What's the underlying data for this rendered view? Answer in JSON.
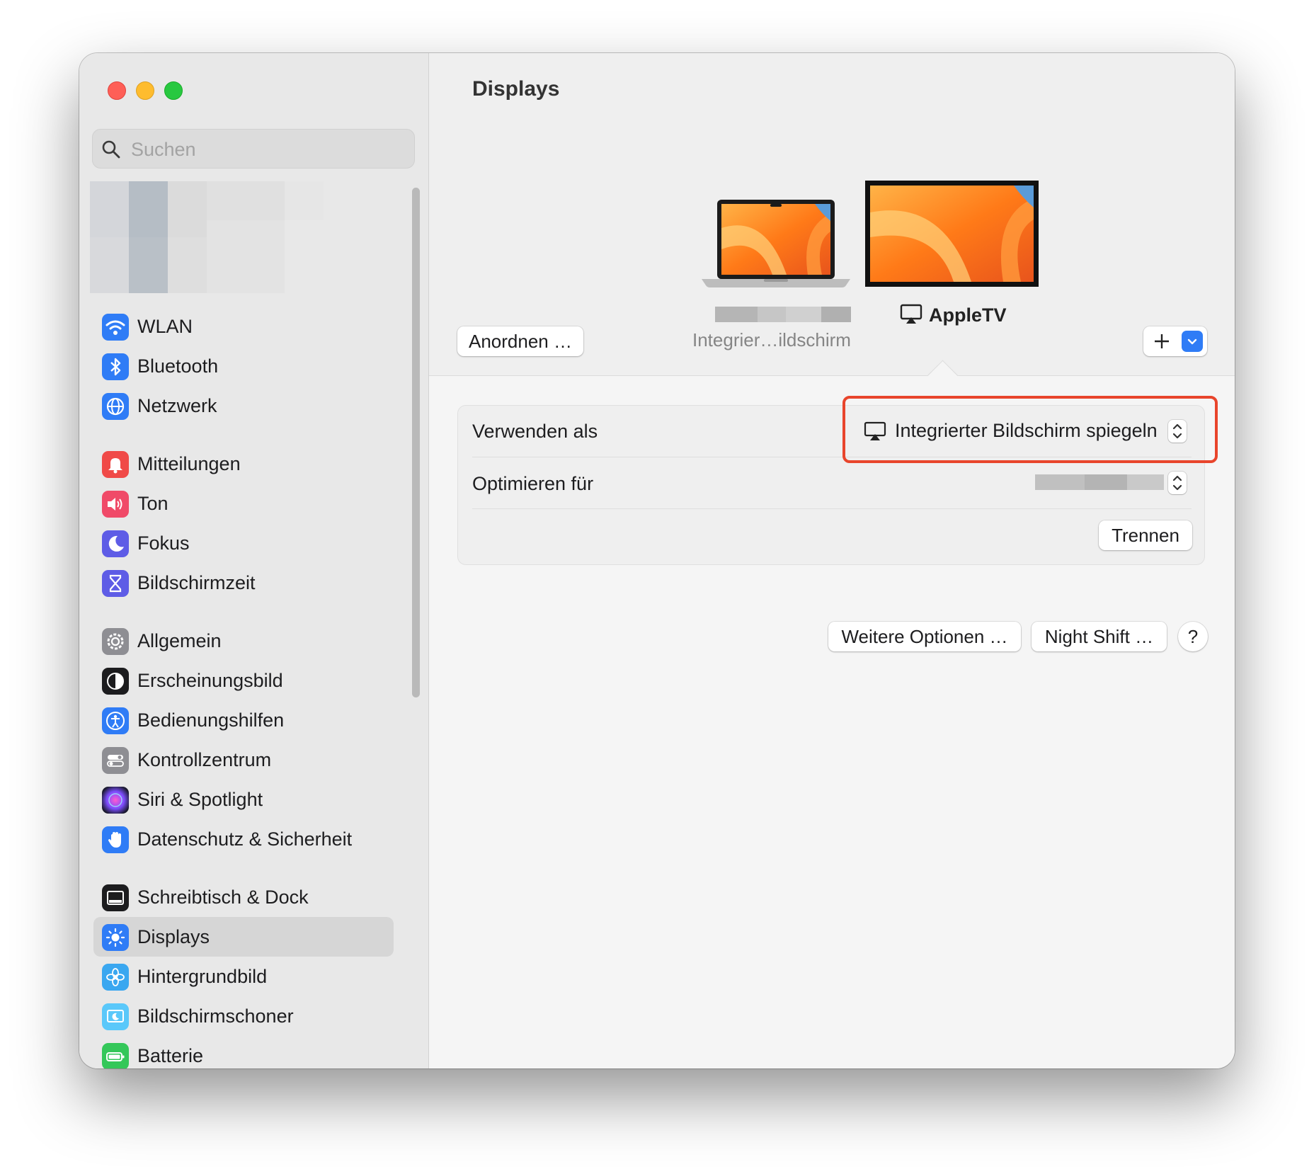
{
  "window": {
    "title": "Displays"
  },
  "search": {
    "placeholder": "Suchen",
    "icon": "magnifier-icon"
  },
  "sidebar": {
    "items": [
      {
        "label": "WLAN",
        "icon": "wifi-icon",
        "color": "#2f7cf6"
      },
      {
        "label": "Bluetooth",
        "icon": "bluetooth-icon",
        "color": "#2f7cf6"
      },
      {
        "label": "Netzwerk",
        "icon": "globe-icon",
        "color": "#2f7cf6"
      },
      {
        "label": "Mitteilungen",
        "icon": "bell-icon",
        "color": "#f04a48"
      },
      {
        "label": "Ton",
        "icon": "speaker-icon",
        "color": "#f04a68"
      },
      {
        "label": "Fokus",
        "icon": "moon-icon",
        "color": "#5e5ce6"
      },
      {
        "label": "Bildschirmzeit",
        "icon": "hourglass-icon",
        "color": "#5e5ce6"
      },
      {
        "label": "Allgemein",
        "icon": "gear-icon",
        "color": "#8e8e93"
      },
      {
        "label": "Erscheinungsbild",
        "icon": "appearance-icon",
        "color": "#1c1c1e"
      },
      {
        "label": "Bedienungshilfen",
        "icon": "accessibility-icon",
        "color": "#2f7cf6"
      },
      {
        "label": "Kontrollzentrum",
        "icon": "toggles-icon",
        "color": "#8e8e93"
      },
      {
        "label": "Siri & Spotlight",
        "icon": "siri-icon",
        "color": "#6a3bd8"
      },
      {
        "label": "Datenschutz & Sicherheit",
        "icon": "hand-icon",
        "color": "#2f7cf6"
      },
      {
        "label": "Schreibtisch & Dock",
        "icon": "dock-icon",
        "color": "#1c1c1e"
      },
      {
        "label": "Displays",
        "icon": "sun-icon",
        "color": "#2f7cf6",
        "selected": true
      },
      {
        "label": "Hintergrundbild",
        "icon": "flower-icon",
        "color": "#3aa7f0"
      },
      {
        "label": "Bildschirmschoner",
        "icon": "screensaver-icon",
        "color": "#5ac8fa"
      },
      {
        "label": "Batterie",
        "icon": "battery-icon",
        "color": "#34c759"
      }
    ]
  },
  "arrangement": {
    "arrange_button": "Anordnen …",
    "builtin_label": "Integrier…ildschirm",
    "appletv_label": "AppleTV",
    "add_button_icon": "plus-icon",
    "dropdown_icon": "chevron-down-icon"
  },
  "settings": {
    "use_as_label": "Verwenden als",
    "use_as_value": "Integrierter Bildschirm spiegeln",
    "optimize_label": "Optimieren für",
    "disconnect_button": "Trennen"
  },
  "footer": {
    "more_options": "Weitere Optionen …",
    "night_shift": "Night Shift …",
    "help": "?"
  },
  "colors": {
    "accent": "#2f7cf6",
    "highlight": "#e8452c"
  }
}
